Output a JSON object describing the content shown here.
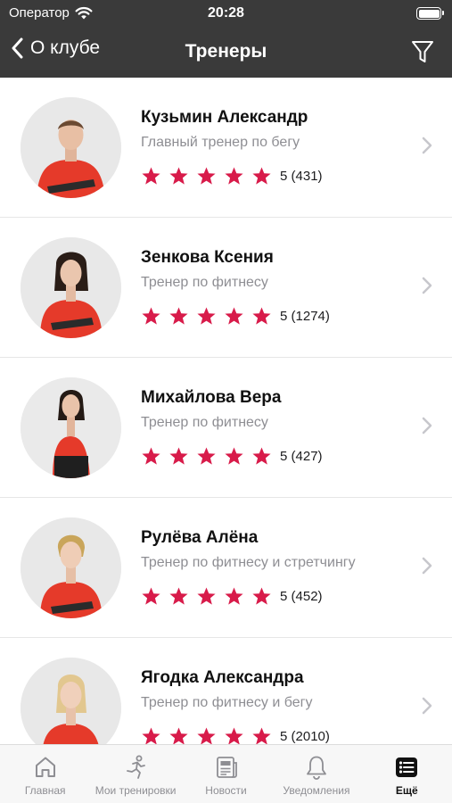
{
  "status": {
    "carrier": "Оператор",
    "time": "20:28"
  },
  "nav": {
    "back_label": "О клубе",
    "title": "Тренеры"
  },
  "trainers": [
    {
      "name": "Кузьмин Александр",
      "role": "Главный тренер по бегу",
      "rating": "5 (431)",
      "stars": 5
    },
    {
      "name": "Зенкова Ксения",
      "role": "Тренер по фитнесу",
      "rating": "5 (1274)",
      "stars": 5
    },
    {
      "name": "Михайлова Вера",
      "role": "Тренер по фитнесу",
      "rating": "5 (427)",
      "stars": 5
    },
    {
      "name": "Рулёва Алёна",
      "role": "Тренер по фитнесу и стретчингу",
      "rating": "5 (452)",
      "stars": 5
    },
    {
      "name": "Ягодка Александра",
      "role": "Тренер по фитнесу и бегу",
      "rating": "5 (2010)",
      "stars": 5
    }
  ],
  "tabs": [
    {
      "label": "Главная",
      "icon": "home-icon"
    },
    {
      "label": "Мои тренировки",
      "icon": "runner-icon"
    },
    {
      "label": "Новости",
      "icon": "news-icon"
    },
    {
      "label": "Уведомления",
      "icon": "bell-icon"
    },
    {
      "label": "Ещё",
      "icon": "more-list-icon",
      "active": true
    }
  ],
  "colors": {
    "accent": "#d81b4a",
    "bar": "#3a3a3a",
    "muted": "#8e8e93"
  }
}
